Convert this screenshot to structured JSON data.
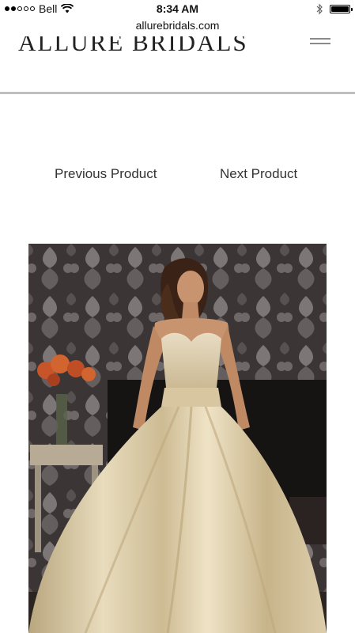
{
  "status_bar": {
    "carrier": "Bell",
    "signal_bars_filled": 2,
    "signal_bars_total": 5,
    "time": "8:34 AM",
    "icons": [
      "wifi-icon",
      "bluetooth-icon",
      "battery-icon"
    ]
  },
  "browser": {
    "url": "allurebridals.com"
  },
  "header": {
    "logo_text": "ALLURE BRIDALS",
    "menu_icon": "hamburger-menu-icon"
  },
  "product_nav": {
    "previous_label": "Previous Product",
    "next_label": "Next Product"
  },
  "product": {
    "image_alt": "Model in a champagne satin strapless ball gown with beaded sweetheart bodice",
    "colors": {
      "gown": "#d9c9a4",
      "wallpaper": "#3b3535",
      "flowers": "#c8552a"
    }
  }
}
